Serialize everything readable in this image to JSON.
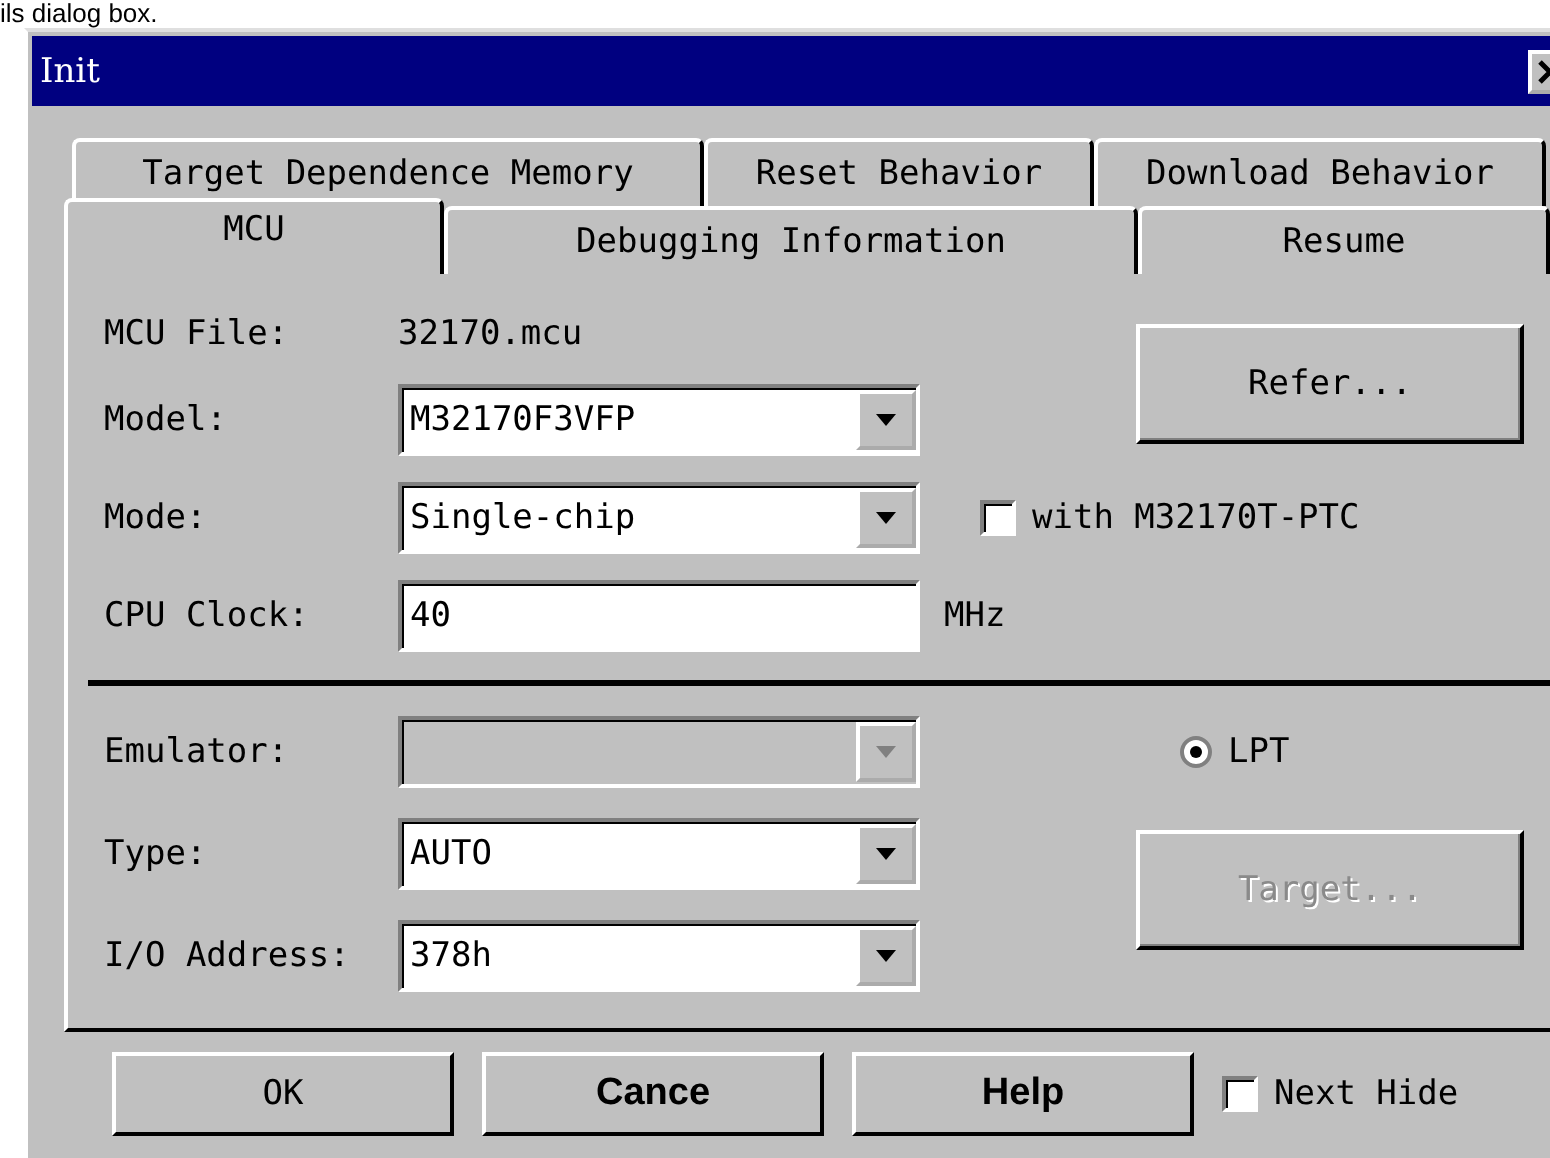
{
  "caption": "ils dialog box.",
  "window": {
    "title": "Init"
  },
  "tab_rows": [
    [
      {
        "label": "Target Dependence Memory",
        "selected": false
      },
      {
        "label": "Reset Behavior",
        "selected": false
      },
      {
        "label": "Download Behavior",
        "selected": false
      }
    ],
    [
      {
        "label": "MCU",
        "selected": true
      },
      {
        "label": "Debugging Information",
        "selected": false
      },
      {
        "label": "Resume",
        "selected": false
      }
    ]
  ],
  "sections": [
    {
      "fields": [
        {
          "kind": "static",
          "label": "MCU File:",
          "value": "32170.mcu"
        },
        {
          "kind": "combo",
          "label": "Model:",
          "value": "M32170F3VFP",
          "disabled": false
        },
        {
          "kind": "combo",
          "label": "Mode:",
          "value": "Single-chip",
          "disabled": false
        },
        {
          "kind": "text",
          "label": "CPU Clock:",
          "value": "40",
          "unit": "MHz"
        }
      ],
      "controls": [
        {
          "kind": "button",
          "label": "Refer...",
          "disabled": false
        },
        {
          "kind": "checkbox",
          "label": "with M32170T-PTC",
          "checked": false
        }
      ]
    },
    {
      "fields": [
        {
          "kind": "combo",
          "label": "Emulator:",
          "disabled": true
        },
        {
          "kind": "combo",
          "label": "Type:",
          "value": "AUTO",
          "disabled": false
        },
        {
          "kind": "combo",
          "label": "I/O Address:",
          "value": "378h",
          "disabled": false
        }
      ],
      "controls": [
        {
          "kind": "radio",
          "label": "LPT",
          "selected": true
        },
        {
          "kind": "button",
          "label": "Target...",
          "disabled": true
        }
      ]
    }
  ],
  "buttons": [
    {
      "label": "OK",
      "bold": false
    },
    {
      "label": "Cance",
      "bold": true
    },
    {
      "label": "Help",
      "bold": true
    }
  ],
  "next_hide": {
    "label": "Next Hide",
    "checked": false
  }
}
